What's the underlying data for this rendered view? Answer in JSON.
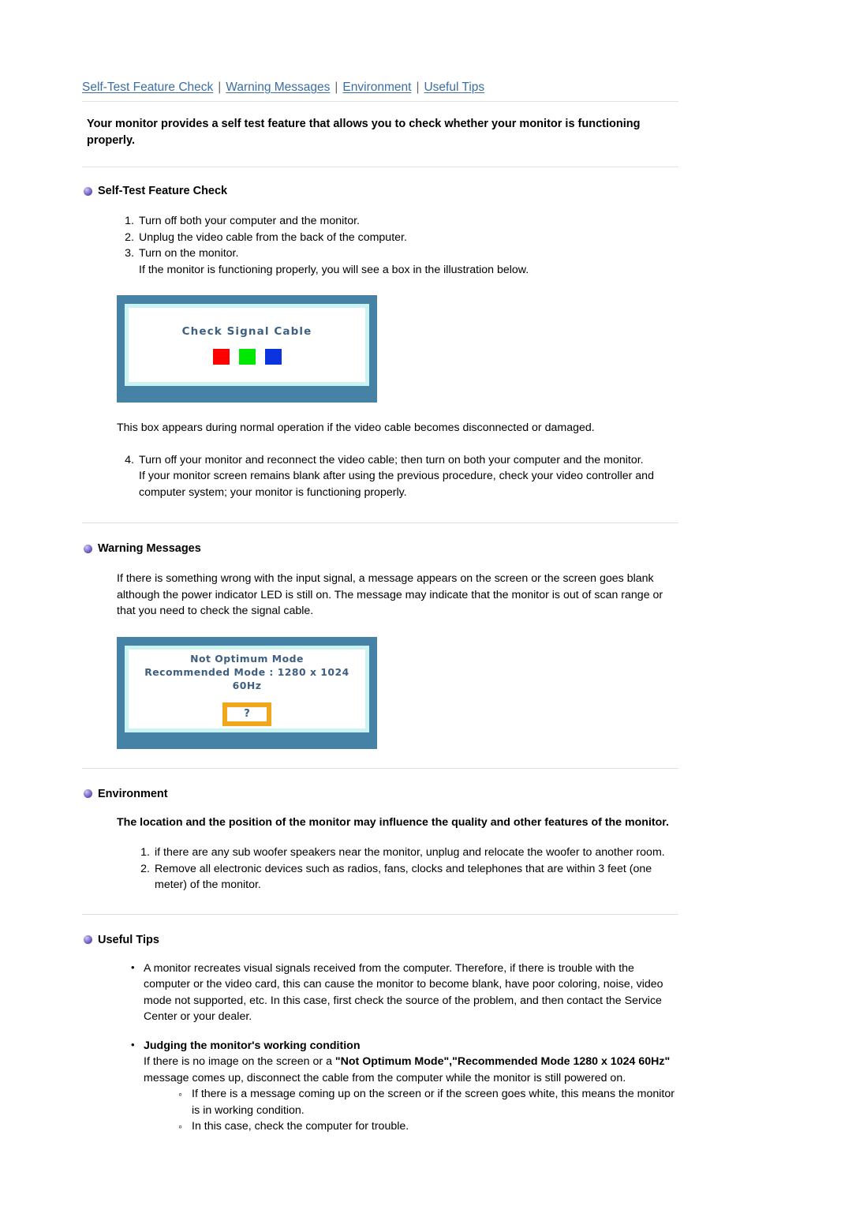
{
  "nav": {
    "items": [
      {
        "label": "Self-Test Feature Check"
      },
      {
        "label": "Warning Messages"
      },
      {
        "label": "Environment"
      },
      {
        "label": "Useful Tips"
      }
    ],
    "separator": "|"
  },
  "intro": "Your monitor provides a self test feature that allows you to check whether your monitor is functioning properly.",
  "sections": {
    "self_test": {
      "heading": "Self-Test Feature Check",
      "steps": [
        {
          "num": "1.",
          "text": "Turn off both your computer and the monitor."
        },
        {
          "num": "2.",
          "text": "Unplug the video cable from the back of the computer."
        },
        {
          "num": "3.",
          "text": "Turn on the monitor."
        }
      ],
      "step3_extra": "If the monitor is functioning properly, you will see a box in the illustration below.",
      "figure": {
        "osd_title": "Check Signal Cable",
        "swatch_colors": [
          "#ff0000",
          "#00e800",
          "#0b33e0"
        ],
        "bezel_color": "#4682a6",
        "screen_border_color": "#c9f4f1"
      },
      "after_figure": "This box appears during normal operation if the video cable becomes disconnected or damaged.",
      "step4": {
        "num": "4.",
        "text": "Turn off your monitor and reconnect the video cable; then turn on both your computer and the monitor.",
        "extra": "If your monitor screen remains blank after using the previous procedure, check your video controller and computer system; your monitor is functioning properly."
      }
    },
    "warning": {
      "heading": "Warning Messages",
      "paragraph": "If there is something wrong with the input signal, a message appears on the screen or the screen goes blank although the power indicator LED is still on. The message may indicate that the monitor is out of scan range or that you need to check the signal cable.",
      "figure": {
        "osd_line1": "Not Optimum Mode",
        "osd_line2": "Recommended Mode : 1280 x 1024  60Hz",
        "question_mark": "?",
        "question_box_color": "#f0a71e",
        "bezel_color": "#4682a6",
        "screen_border_color": "#c9f4f1"
      }
    },
    "environment": {
      "heading": "Environment",
      "subheading": "The location and the position of the monitor may influence the quality and other features of the monitor.",
      "steps": [
        {
          "num": "1.",
          "text": "if there are any sub woofer speakers near the monitor, unplug and relocate the woofer to another room."
        },
        {
          "num": "2.",
          "text": "Remove all electronic devices such as radios, fans, clocks and telephones that are within 3 feet (one meter) of the monitor."
        }
      ]
    },
    "useful_tips": {
      "heading": "Useful Tips",
      "bullet1": "A monitor recreates visual signals received from the computer. Therefore, if there is trouble with the computer or the video card, this can cause the monitor to become blank, have poor coloring, noise, video mode not supported, etc. In this case, first check the source of the problem, and then contact the Service Center or your dealer.",
      "bullet2_title": "Judging the monitor's working condition",
      "bullet2_text_a": "If there is no image on the screen or a ",
      "bullet2_bold_a": "\"Not Optimum Mode\",\"Recommended Mode 1280 x 1024 60Hz\"",
      "bullet2_text_b": " message comes up, disconnect the cable from the computer while the monitor is still powered on.",
      "sub_bullets": [
        {
          "text": "If there is a message coming up on the screen or if the screen goes white, this means the monitor is in working condition."
        },
        {
          "text": "In this case, check the computer for trouble."
        }
      ]
    }
  },
  "colors": {
    "nav_link": "#3a6ea5",
    "rule": "#e2e2e2",
    "bullet_ball": "#5b4fb0",
    "osd_text": "#3e5f80"
  }
}
